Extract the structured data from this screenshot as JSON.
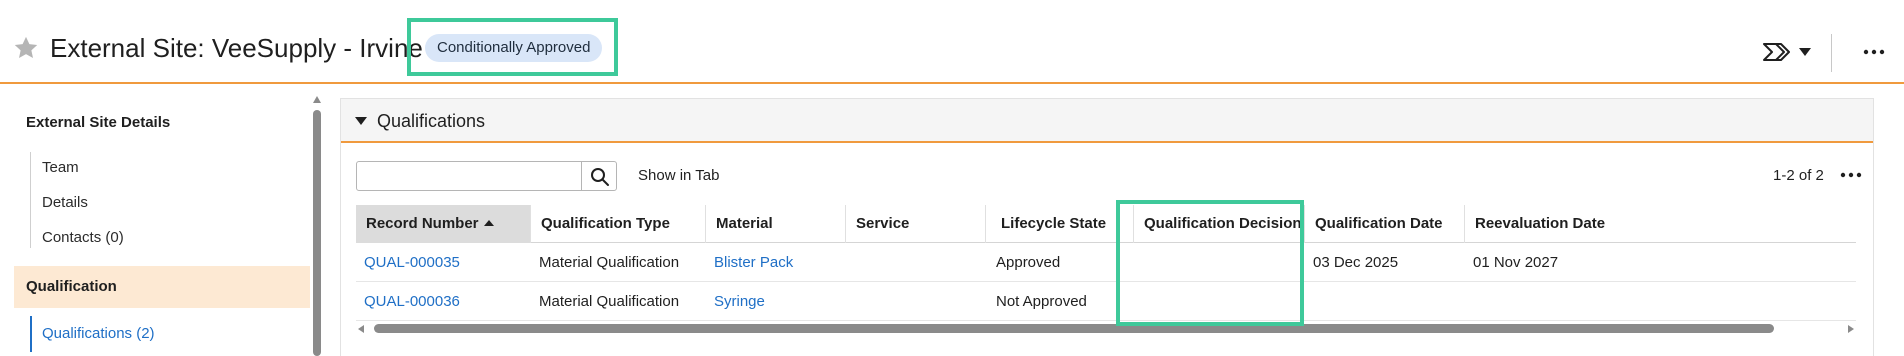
{
  "header": {
    "title": "External Site: VeeSupply - Irvine",
    "status_badge": "Conditionally Approved",
    "accent_color": "#f09a3e",
    "highlight_color": "#3ec99a",
    "icons": [
      "star-icon",
      "workflow-icon",
      "chevron-down-icon",
      "more-icon"
    ]
  },
  "sidebar": {
    "heading": "External Site Details",
    "items": [
      {
        "label": "Team"
      },
      {
        "label": "Details"
      },
      {
        "label": "Contacts (0)"
      }
    ],
    "active_group": "Qualification",
    "sub_items": [
      {
        "label": "Qualifications (2)"
      }
    ]
  },
  "section": {
    "title": "Qualifications",
    "search": {
      "value": "",
      "placeholder": ""
    },
    "show_in_tab": "Show in Tab",
    "pager": "1-2 of 2",
    "table": {
      "columns": [
        "Record Number",
        "Qualification Type",
        "Material",
        "Service",
        "Lifecycle State",
        "Qualification Decision",
        "Qualification Date",
        "Reevaluation Date"
      ],
      "sorted_column": "Record Number",
      "sort_direction": "ascending",
      "rows": [
        {
          "record_number": "QUAL-000035",
          "qualification_type": "Material Qualification",
          "material": "Blister Pack",
          "service": "",
          "lifecycle_state": "Approved",
          "qualification_decision": "",
          "qualification_date": "03 Dec 2025",
          "reevaluation_date": "01 Nov 2027"
        },
        {
          "record_number": "QUAL-000036",
          "qualification_type": "Material Qualification",
          "material": "Syringe",
          "service": "",
          "lifecycle_state": "Not Approved",
          "qualification_decision": "",
          "qualification_date": "",
          "reevaluation_date": ""
        }
      ]
    }
  }
}
